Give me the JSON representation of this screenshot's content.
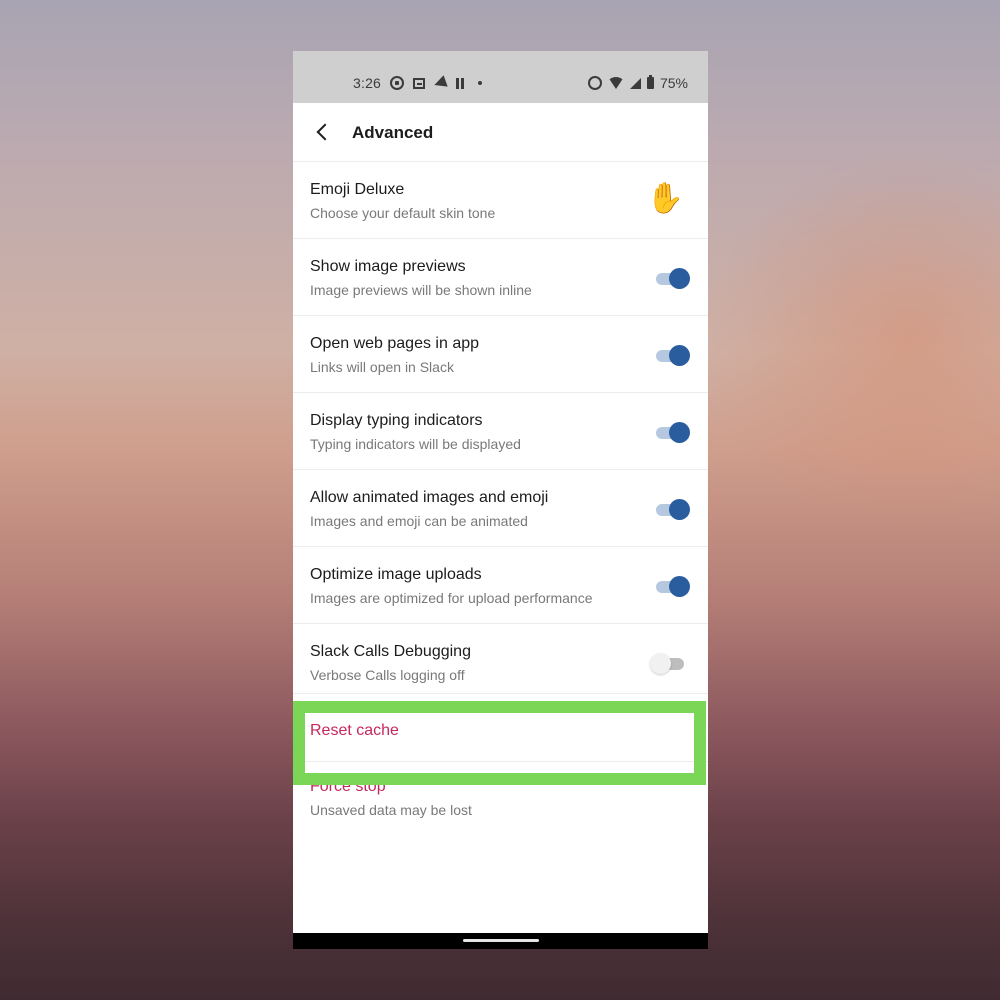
{
  "status_bar": {
    "time": "3:26",
    "left_icons": [
      "whatsapp-icon",
      "news-icon",
      "telegram-icon",
      "pause-icon",
      "dot-icon"
    ],
    "right_icons": [
      "alarm-icon",
      "wifi-icon",
      "signal-icon",
      "battery-icon"
    ],
    "battery": "75%"
  },
  "app_bar": {
    "back_icon": "chevron-left-icon",
    "title": "Advanced"
  },
  "settings": [
    {
      "title": "Emoji Deluxe",
      "subtitle": "Choose your default skin tone",
      "control": "emoji",
      "emoji": "✋"
    },
    {
      "title": "Show image previews",
      "subtitle": "Image previews will be shown inline",
      "control": "toggle",
      "on": true
    },
    {
      "title": "Open web pages in app",
      "subtitle": "Links will open in Slack",
      "control": "toggle",
      "on": true
    },
    {
      "title": "Display typing indicators",
      "subtitle": "Typing indicators will be displayed",
      "control": "toggle",
      "on": true
    },
    {
      "title": "Allow animated images and emoji",
      "subtitle": "Images and emoji can be animated",
      "control": "toggle",
      "on": true
    },
    {
      "title": "Optimize image uploads",
      "subtitle": "Images are optimized for upload performance",
      "control": "toggle",
      "on": true
    },
    {
      "title": "Slack Calls Debugging",
      "subtitle": "Verbose Calls logging off",
      "control": "toggle",
      "on": false
    }
  ],
  "actions": [
    {
      "title": "Reset cache",
      "highlighted": true
    },
    {
      "title": "Force stop",
      "subtitle": "Unsaved data may be lost"
    }
  ],
  "colors": {
    "toggle_on": "#2a5d9e",
    "action_text": "#c6285c",
    "highlight": "#7bd657"
  }
}
